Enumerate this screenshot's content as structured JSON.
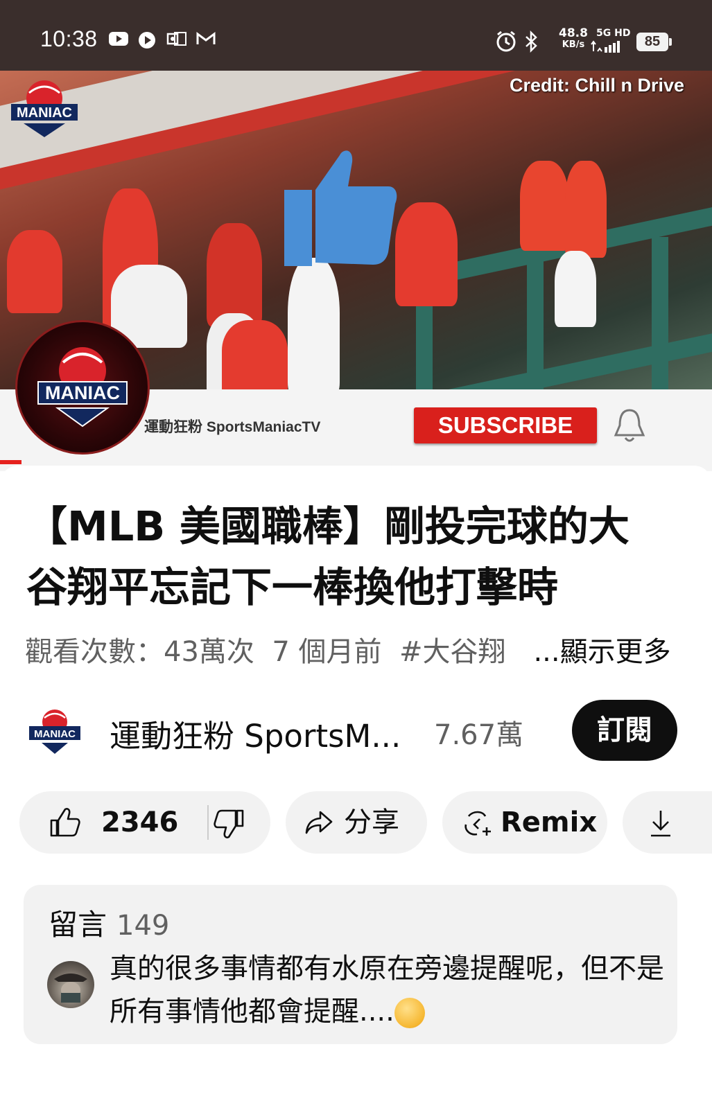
{
  "status_bar": {
    "time": "10:38",
    "speed_value": "48.8",
    "speed_unit": "KB/s",
    "network": "5G HD",
    "battery": "85"
  },
  "video": {
    "credit": "Credit: Chill n Drive",
    "channel_watermark": "運動狂粉 SportsManiacTV",
    "subscribe_overlay": "SUBSCRIBE",
    "progress": 0.03
  },
  "title": "【MLB 美國職棒】剛投完球的大谷翔平忘記下一棒換他打擊時",
  "meta": {
    "views": "觀看次數：43萬次",
    "age": "7 個月前",
    "hashtag": "#大谷翔",
    "more": "...顯示更多"
  },
  "channel": {
    "name": "運動狂粉 SportsM...",
    "subscribers": "7.67萬",
    "subscribe_label": "訂閱"
  },
  "actions": {
    "likes": "2346",
    "share": "分享",
    "remix": "Remix"
  },
  "comments": {
    "heading": "留言",
    "count": "149",
    "top_comment": "真的很多事情都有水原在旁邊提醒呢，但不是所有事情他都會提醒...."
  }
}
